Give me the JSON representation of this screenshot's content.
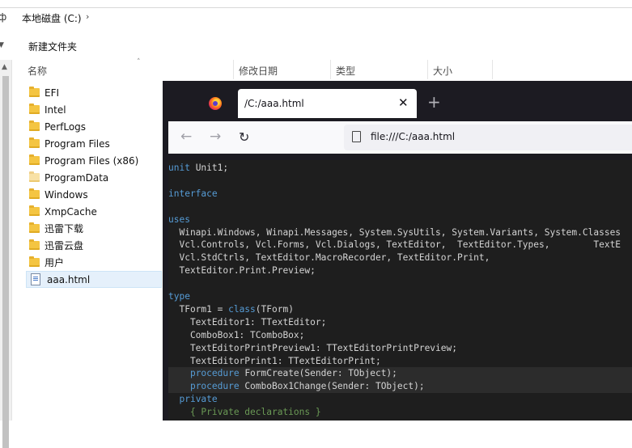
{
  "explorer": {
    "breadcrumb": {
      "left_fragment": "ф",
      "drive": "本地磁盘 (C:)",
      "chevron": "›"
    },
    "toolbar": {
      "new_folder": "新建文件夹"
    },
    "columns": {
      "name": "名称",
      "modified": "修改日期",
      "type": "类型",
      "size": "大小"
    },
    "files": [
      {
        "name": "EFI",
        "kind": "folder"
      },
      {
        "name": "Intel",
        "kind": "folder"
      },
      {
        "name": "PerfLogs",
        "kind": "folder"
      },
      {
        "name": "Program Files",
        "kind": "folder"
      },
      {
        "name": "Program Files (x86)",
        "kind": "folder"
      },
      {
        "name": "ProgramData",
        "kind": "folder-hidden"
      },
      {
        "name": "Windows",
        "kind": "folder"
      },
      {
        "name": "XmpCache",
        "kind": "folder"
      },
      {
        "name": "迅雷下载",
        "kind": "folder"
      },
      {
        "name": "迅雷云盘",
        "kind": "folder"
      },
      {
        "name": "用户",
        "kind": "folder"
      },
      {
        "name": "aaa.html",
        "kind": "html",
        "selected": true
      }
    ]
  },
  "browser": {
    "tab_title": "/C:/aaa.html",
    "url": "file:///C:/aaa.html",
    "icons": {
      "back": "arrow-left",
      "forward": "arrow-right",
      "reload": "reload",
      "close": "close",
      "new_tab": "plus",
      "page": "page"
    },
    "code_lines": [
      {
        "parts": [
          {
            "t": "unit",
            "c": "kw"
          },
          {
            "t": " Unit1;",
            "c": ""
          }
        ]
      },
      {
        "parts": []
      },
      {
        "parts": [
          {
            "t": "interface",
            "c": "kw"
          }
        ]
      },
      {
        "parts": []
      },
      {
        "parts": [
          {
            "t": "uses",
            "c": "kw"
          }
        ]
      },
      {
        "parts": [
          {
            "t": "  Winapi.Windows, Winapi.Messages, System.SysUtils, System.Variants, System.Classes",
            "c": ""
          }
        ]
      },
      {
        "parts": [
          {
            "t": "  Vcl.Controls, Vcl.Forms, Vcl.Dialogs, TextEditor,  TextEditor.Types,        TextE",
            "c": ""
          }
        ]
      },
      {
        "parts": [
          {
            "t": "  Vcl.StdCtrls, TextEditor.MacroRecorder, TextEditor.Print,",
            "c": ""
          }
        ]
      },
      {
        "parts": [
          {
            "t": "  TextEditor.Print.Preview;",
            "c": ""
          }
        ]
      },
      {
        "parts": []
      },
      {
        "parts": [
          {
            "t": "type",
            "c": "kw"
          }
        ]
      },
      {
        "parts": [
          {
            "t": "  TForm1 = ",
            "c": ""
          },
          {
            "t": "class",
            "c": "kw"
          },
          {
            "t": "(TForm)",
            "c": ""
          }
        ]
      },
      {
        "parts": [
          {
            "t": "    TextEditor1: TTextEditor;",
            "c": ""
          }
        ]
      },
      {
        "parts": [
          {
            "t": "    ComboBox1: TComboBox;",
            "c": ""
          }
        ]
      },
      {
        "parts": [
          {
            "t": "    TextEditorPrintPreview1: TTextEditorPrintPreview;",
            "c": ""
          }
        ]
      },
      {
        "parts": [
          {
            "t": "    TextEditorPrint1: TTextEditorPrint;",
            "c": ""
          }
        ]
      },
      {
        "parts": [
          {
            "t": "    ",
            "c": ""
          },
          {
            "t": "procedure",
            "c": "kw"
          },
          {
            "t": " FormCreate(Sender: TObject);",
            "c": ""
          }
        ],
        "highlight": true
      },
      {
        "parts": [
          {
            "t": "    ",
            "c": ""
          },
          {
            "t": "procedure",
            "c": "kw"
          },
          {
            "t": " ComboBox1Change(Sender: TObject);",
            "c": ""
          }
        ],
        "highlight": true
      },
      {
        "parts": [
          {
            "t": "  ",
            "c": ""
          },
          {
            "t": "private",
            "c": "kw"
          }
        ]
      },
      {
        "parts": [
          {
            "t": "    { Private declarations }",
            "c": "cm"
          }
        ]
      }
    ]
  }
}
